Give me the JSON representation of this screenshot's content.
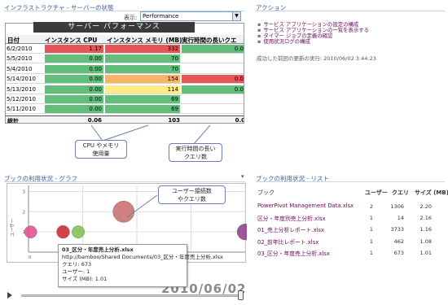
{
  "left_top": {
    "title": "インフラストラクチャ - サーバーの状態",
    "show_label": "表示:",
    "selected_view": "Performance",
    "banner": "サーバー パフォーマンス",
    "columns": [
      "日付",
      "インスタンス CPU",
      "インスタンス メモリ (MB)",
      "実行時間の長いクエ"
    ],
    "rows": [
      {
        "date": "6/2/2010",
        "cpu": "1.17",
        "mem": "332",
        "q": "0.0"
      },
      {
        "date": "5/5/2010",
        "cpu": "0.00",
        "mem": "70",
        "q": ""
      },
      {
        "date": "5/4/2010",
        "cpu": "0.00",
        "mem": "70",
        "q": ""
      },
      {
        "date": "5/14/2010",
        "cpu": "0.00",
        "mem": "154",
        "q": "0.0"
      },
      {
        "date": "5/13/2010",
        "cpu": "0.00",
        "mem": "114",
        "q": "0.0"
      },
      {
        "date": "5/12/2010",
        "cpu": "0.00",
        "mem": "69",
        "q": ""
      },
      {
        "date": "5/11/2010",
        "cpu": "0.00",
        "mem": "69",
        "q": ""
      }
    ],
    "total": {
      "label": "総計",
      "cpu": "0.06",
      "mem": "103",
      "q": "0.0"
    },
    "callout_cpu_mem": "CPU やメモリ\n使用量",
    "callout_queries": "実行時間の長い\nクエリ数"
  },
  "right_top": {
    "title": "アクション",
    "links": [
      "サービス アプリケーションの設定の構成",
      "サービス アプリケーションの一覧を表示する",
      "タイマー ジョブの定義の確認",
      "使用状況ログの構成"
    ],
    "last_update": "成功した前回の更新の実行: 2010/06/02 3:44:23"
  },
  "left_bottom": {
    "title": "ブックの利用状況 - グラフ",
    "callout": "ユーザー接続数\nやクエリ数",
    "y_axis_label": "ユーザー",
    "tooltip": {
      "name": "03_区分・年度売上分析.xlsx",
      "path": "http://bamboo/Shared Documents/03_区分・年度売上分析.xlsx",
      "queries": "クエリ: 673",
      "users": "ユーザー: 1",
      "size": "サイズ (MB): 1.01"
    },
    "date_watermark": "2010/06/02"
  },
  "chart_data": {
    "type": "scatter",
    "title": "",
    "xlabel": "",
    "ylabel": "ユーザー",
    "xlim": [
      -20,
      3000
    ],
    "ylim": [
      0,
      3.3
    ],
    "x_ticks": [
      "0",
      "500",
      "1000"
    ],
    "y_ticks": [
      "1",
      "2",
      "3"
    ],
    "grid": true,
    "points": [
      {
        "x": 10,
        "y": 1,
        "size": 1.0,
        "color": "#e3498f"
      },
      {
        "x": 462,
        "y": 1,
        "size": 1.08,
        "color": "#cc2222"
      },
      {
        "x": 673,
        "y": 1,
        "size": 1.01,
        "color": "#7cc04a"
      },
      {
        "x": 1306,
        "y": 2,
        "size": 2.2,
        "color": "#c96a6a"
      },
      {
        "x": 3000,
        "y": 1,
        "size": 1.5,
        "color": "#8a3a8a"
      }
    ]
  },
  "right_bottom": {
    "title": "ブックの利用状況 - リスト",
    "columns": [
      "ブック",
      "ユーザー",
      "クエリ",
      "サイズ (MB)"
    ],
    "rows": [
      {
        "book": "PowerPivot Management Data.xlsx",
        "users": "2",
        "queries": "1306",
        "size": "2.20"
      },
      {
        "book": "区分・年度別売上分析.xlsx",
        "users": "1",
        "queries": "14",
        "size": "2.16"
      },
      {
        "book": "01_売上分析レポート.xlsx",
        "users": "1",
        "queries": "3733",
        "size": "1.16"
      },
      {
        "book": "02_前年比レポート.xlsx",
        "users": "1",
        "queries": "462",
        "size": "1.08"
      },
      {
        "book": "03_区分・年度売上分析.xlsx",
        "users": "1",
        "queries": "673",
        "size": "1.01"
      }
    ]
  },
  "colors": {
    "title_blue": "#3b5e91",
    "link_purple": "#6a0a5a",
    "cell_red": "#e35757",
    "cell_green": "#63be7b",
    "cell_yellow": "#ffeb84",
    "cell_orange": "#f8b36b"
  }
}
